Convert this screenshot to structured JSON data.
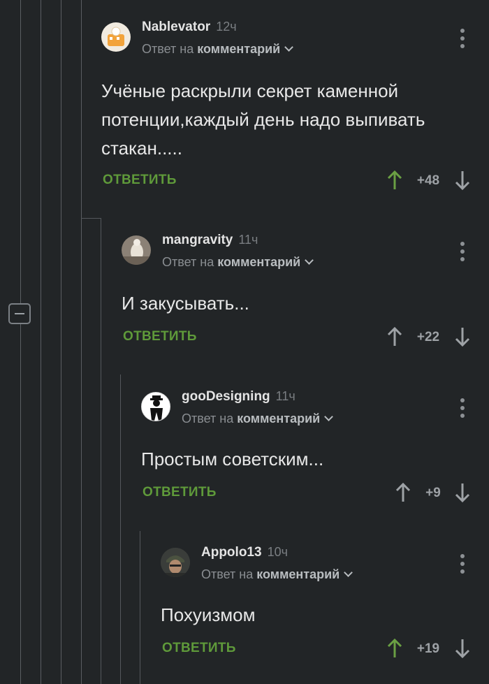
{
  "thread": {
    "reply_preposition": "Ответ на",
    "reply_target": "комментарий",
    "reply_button": "ОТВЕТИТЬ",
    "comments": [
      {
        "author": "Nablevator",
        "time": "12ч",
        "text_lines": [
          "Учёные раскрыли секрет каменной",
          "потенции,каждый день надо выпивать",
          "стакан....."
        ],
        "rating": "+48",
        "upvoted": true
      },
      {
        "author": "mangravity",
        "time": "11ч",
        "text_lines": [
          "И закусывать..."
        ],
        "rating": "+22",
        "upvoted": false
      },
      {
        "author": "gooDesigning",
        "time": "11ч",
        "text_lines": [
          "Простым советским..."
        ],
        "rating": "+9",
        "upvoted": false
      },
      {
        "author": "Appolo13",
        "time": "10ч",
        "text_lines": [
          "Похуизмом"
        ],
        "rating": "+19",
        "upvoted": true
      }
    ]
  },
  "colors": {
    "background": "#222527",
    "reply_green": "#5f9a3a",
    "upvote_active": "#6aa043",
    "arrow_inactive": "#9ea2a6"
  },
  "icons": {
    "collapse": "minus-square-icon",
    "menu": "more-vertical-icon",
    "upvote": "arrow-up-icon",
    "downvote": "arrow-down-icon"
  }
}
